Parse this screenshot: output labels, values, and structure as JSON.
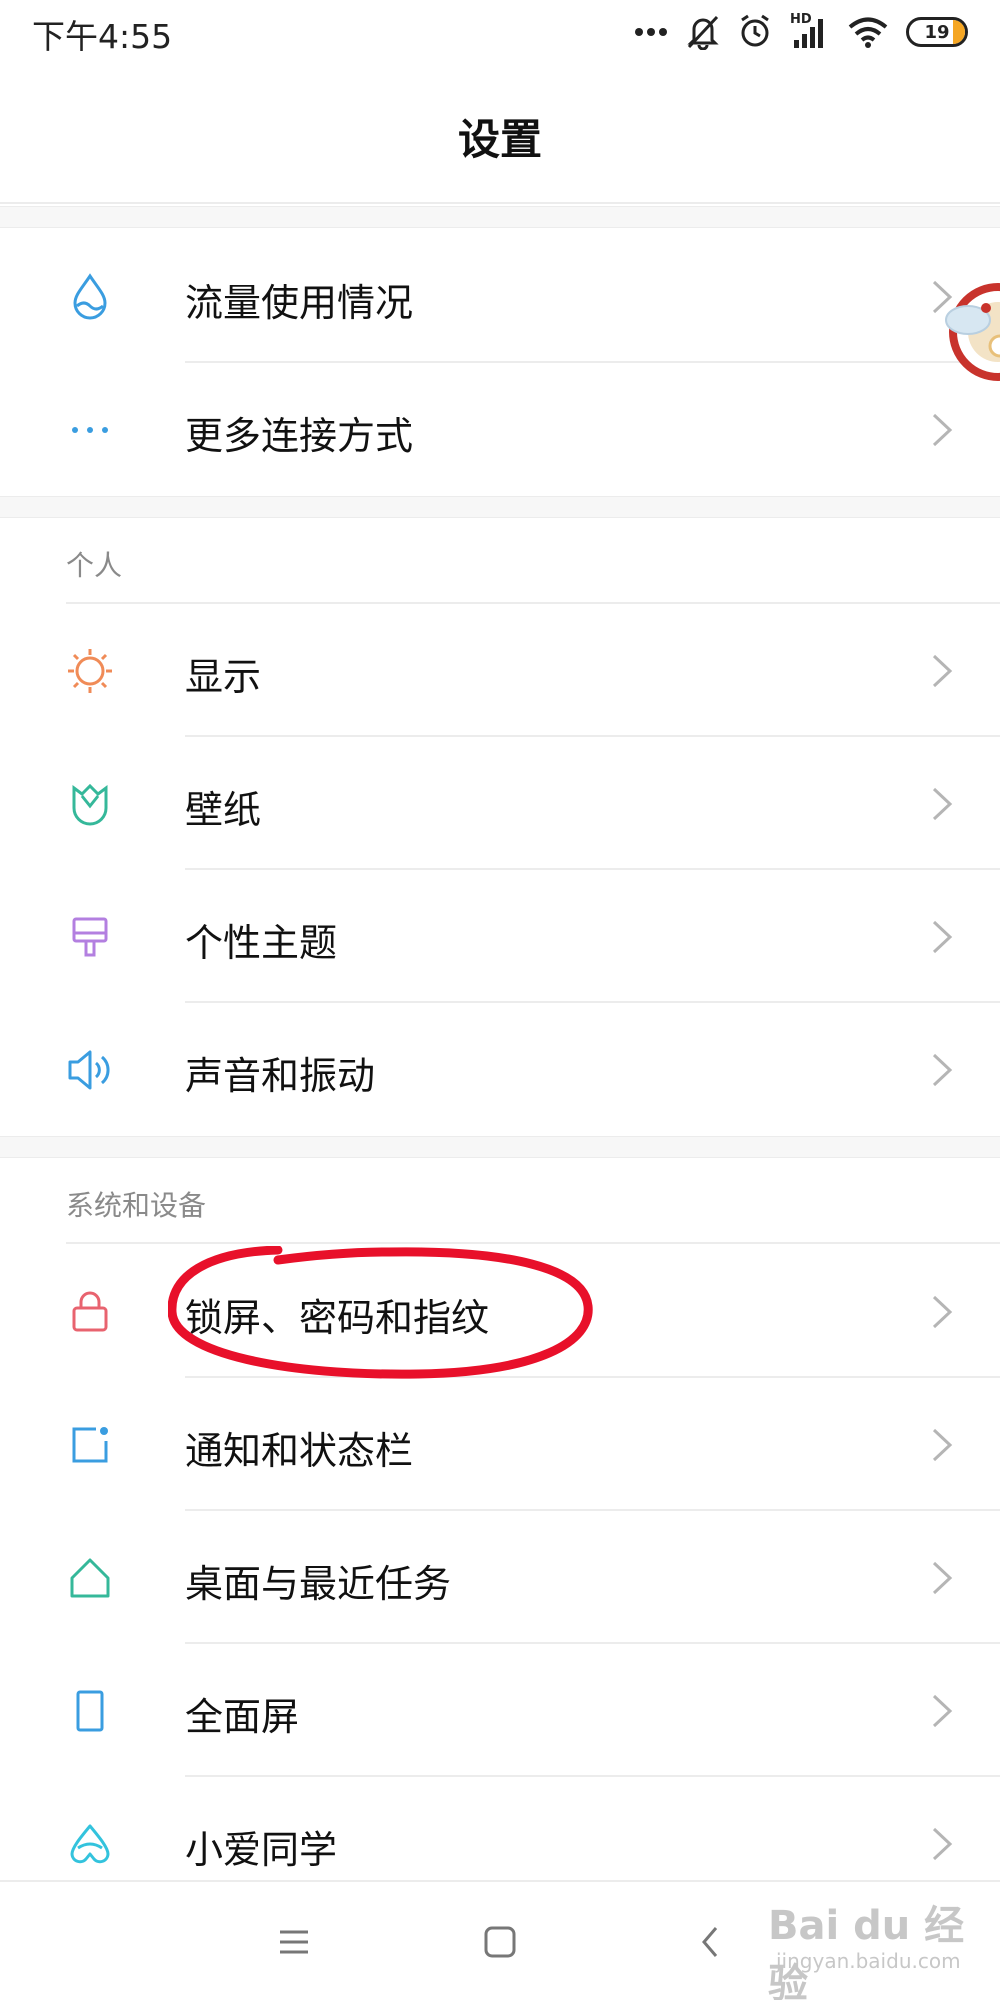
{
  "status_bar": {
    "time": "下午4:55",
    "network_label": "HD",
    "battery_level": "19",
    "icons": [
      "more-dots-icon",
      "silent-bell-icon",
      "alarm-icon",
      "signal-icon",
      "wifi-icon",
      "battery-icon"
    ]
  },
  "header": {
    "title": "设置"
  },
  "groups": {
    "connection": {
      "items": [
        {
          "label": "流量使用情况",
          "icon": "data-usage-icon",
          "color": "#3a9de0"
        },
        {
          "label": "更多连接方式",
          "icon": "more-connections-icon",
          "color": "#3a9de0"
        }
      ]
    },
    "personal": {
      "header": "个人",
      "items": [
        {
          "label": "显示",
          "icon": "display-icon",
          "color": "#f08b57"
        },
        {
          "label": "壁纸",
          "icon": "wallpaper-icon",
          "color": "#35b89a"
        },
        {
          "label": "个性主题",
          "icon": "theme-icon",
          "color": "#b37fe0"
        },
        {
          "label": "声音和振动",
          "icon": "sound-icon",
          "color": "#3a9de0"
        }
      ]
    },
    "system": {
      "header": "系统和设备",
      "items": [
        {
          "label": "锁屏、密码和指纹",
          "icon": "lock-icon",
          "color": "#e8636f"
        },
        {
          "label": "通知和状态栏",
          "icon": "notification-icon",
          "color": "#3a9de0"
        },
        {
          "label": "桌面与最近任务",
          "icon": "home-icon",
          "color": "#35b89a"
        },
        {
          "label": "全面屏",
          "icon": "fullscreen-icon",
          "color": "#3a9de0"
        },
        {
          "label": "小爱同学",
          "icon": "xiaoai-icon",
          "color": "#33c3dd"
        }
      ]
    }
  },
  "annotation": {
    "color": "#e8102a"
  },
  "navigation": {
    "buttons": [
      "menu-icon",
      "home-square-icon",
      "back-icon"
    ]
  },
  "watermark": {
    "main": "Bai du 经验",
    "sub": "jingyan.baidu.com"
  }
}
